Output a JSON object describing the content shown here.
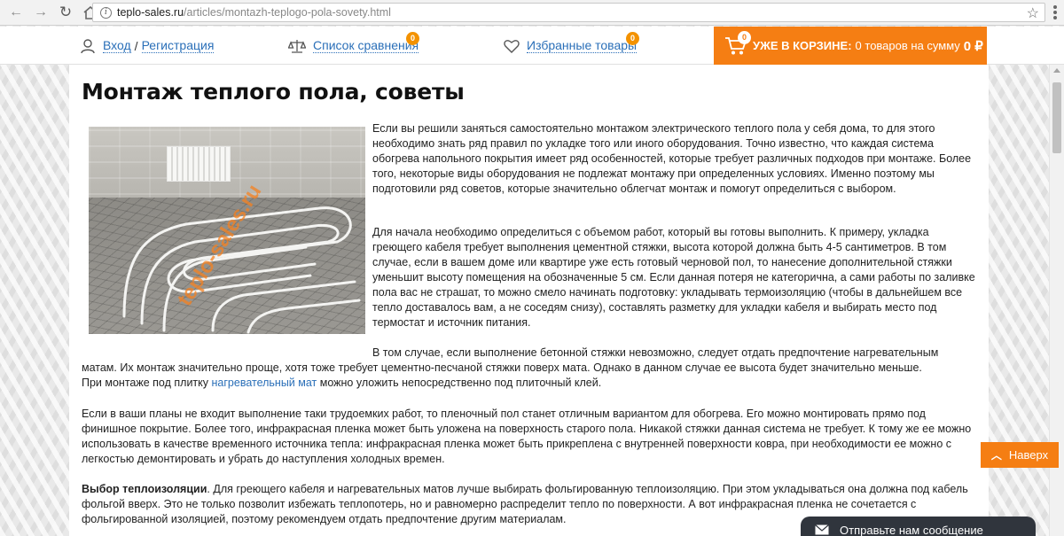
{
  "browser": {
    "url_host": "teplo-sales.ru",
    "url_path": "/articles/montazh-teplogo-pola-sovety.html"
  },
  "header": {
    "login": "Вход",
    "login_sep": "/",
    "register": "Регистрация",
    "compare": "Список сравнения",
    "compare_count": "0",
    "favorites": "Избранные товары",
    "favorites_count": "0",
    "cart_count": "0",
    "cart_label": "УЖЕ В КОРЗИНЕ:",
    "cart_summary": "0 товаров на сумму",
    "cart_total": "0 ₽"
  },
  "article": {
    "title": "Монтаж теплого пола, советы",
    "image_watermark": "teplo-sales.ru",
    "p1": "Если вы решили заняться самостоятельно монтажом электрического теплого пола у себя дома, то для этого необходимо знать ряд правил по укладке того или иного оборудования. Точно известно, что каждая система обогрева напольного покрытия имеет ряд особенностей, которые требует различных подходов при монтаже. Более того, некоторые виды оборудования не подлежат монтажу при определенных условиях. Именно поэтому мы подготовили ряд советов, которые значительно облегчат монтаж и помогут определиться с выбором.",
    "p2": "Для начала необходимо определиться с объемом работ, который вы готовы выполнить. К примеру, укладка греющего кабеля требует выполнения цементной стяжки, высота которой должна быть 4-5 сантиметров. В том случае, если в вашем доме или квартире уже есть готовый черновой пол, то нанесение дополнительной стяжки уменьшит высоту помещения на обозначенные 5 см. Если данная потеря не категорична, а сами работы по заливке пола вас не страшат, то можно смело начинать подготовку: укладывать термоизоляцию (чтобы в дальнейшем все тепло доставалось вам, а не соседям снизу), составлять разметку для укладки кабеля и выбирать место под термостат и источник питания.",
    "p3_line1": "В том случае, если выполнение бетонной стяжки невозможно, следует отдать предпочтение нагревательным",
    "p3_line2": "матам. Их монтаж значительно проще, хотя тоже требует цементно-песчаной стяжки поверх мата. Однако в данном случае ее высота будет значительно меньше.",
    "p3_line3_before": "При монтаже под плитку",
    "p3_link": "нагревательный мат",
    "p3_line3_after": "можно уложить непосредственно под плиточный клей.",
    "p4": "Если в ваши планы не входит выполнение таки трудоемких работ, то пленочный пол станет отличным вариантом для обогрева. Его можно монтировать прямо под финишное покрытие. Более того, инфракрасная пленка может быть уложена на поверхность старого пола. Никакой стяжки данная система не требует. К тому же ее можно использовать в качестве временного источника тепла: инфракрасная пленка может быть прикреплена с внутренней поверхности ковра, при необходимости ее можно с легкостью демонтировать и убрать до наступления холодных времен.",
    "p5_bold": "Выбор теплоизоляции",
    "p5_rest": ". Для греющего кабеля и нагревательных матов лучше выбирать фольгированную теплоизоляцию. При этом укладываться она должна под кабель фольгой вверх. Это не только позволит избежать теплопотерь, но и равномерно распределит тепло по поверхности. А вот инфракрасная пленка не сочетается с фольгированной изоляцией, поэтому рекомендуем отдать предпочтение другим материалам."
  },
  "widgets": {
    "next_label": "Наверх",
    "chat_label": "Отправьте нам сообщение"
  },
  "colors": {
    "accent": "#f57e13",
    "link": "#2a6fb8",
    "chat_bg": "#30353d"
  },
  "icons": [
    "back-icon",
    "forward-icon",
    "reload-icon",
    "home-icon",
    "info-icon",
    "star-icon",
    "menu-icon",
    "user-icon",
    "scales-icon",
    "heart-icon",
    "cart-icon",
    "chevron-up-icon",
    "mail-icon"
  ]
}
